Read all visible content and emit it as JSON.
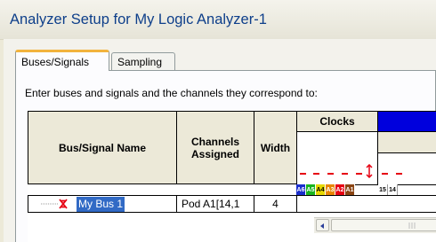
{
  "window": {
    "title": "Analyzer Setup for My Logic Analyzer-1"
  },
  "tabs": [
    {
      "label": "Buses/Signals",
      "active": true
    },
    {
      "label": "Sampling",
      "active": false
    }
  ],
  "instructions": "Enter buses and signals and the channels they correspond to:",
  "table": {
    "headers": {
      "name": "Bus/Signal Name",
      "channels": "Channels\nAssigned",
      "width": "Width",
      "clocks": "Clocks"
    },
    "clock_channels": [
      {
        "label": "A6",
        "color": "#1a2ecc"
      },
      {
        "label": "A5",
        "color": "#19b41e"
      },
      {
        "label": "A4",
        "color": "#e6d800"
      },
      {
        "label": "A3",
        "color": "#e88500"
      },
      {
        "label": "A2",
        "color": "#e60012"
      },
      {
        "label": "A1",
        "color": "#8b4513"
      }
    ],
    "data_channels": [
      "15",
      "14"
    ],
    "rows": [
      {
        "name": "My Bus 1",
        "channels": "Pod A1[14,1",
        "width": "4"
      }
    ]
  },
  "icons": {
    "bus": "bus-icon",
    "scroll_left": "scroll-left-arrow-icon",
    "scroll_thumb": "scroll-grip-icon"
  },
  "colors": {
    "title_text": "#0e3f8a",
    "tab_highlight": "#f2b33d",
    "row_selected": "#316ac5",
    "header_bg": "#ece9d8",
    "blue_header": "#0000dd"
  }
}
